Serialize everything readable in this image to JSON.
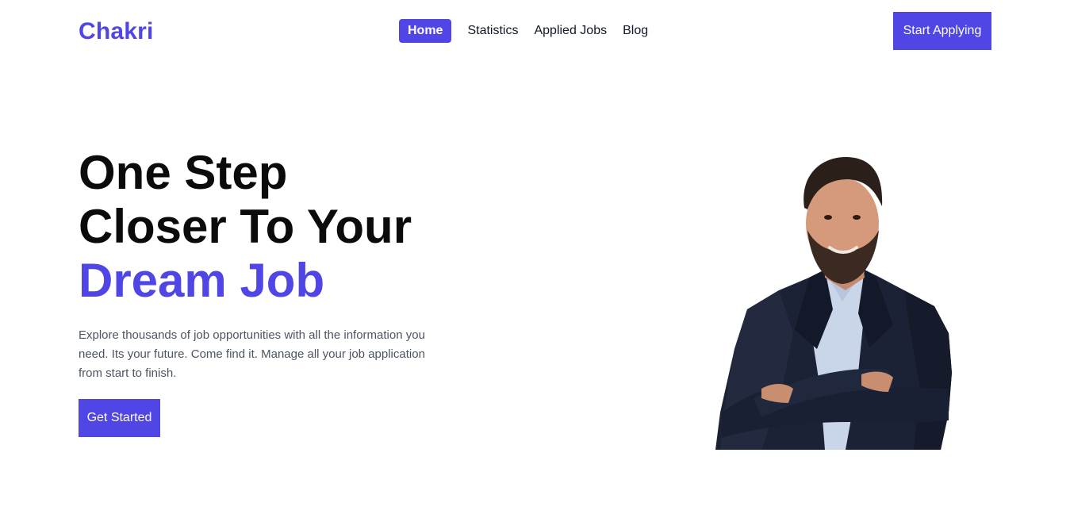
{
  "header": {
    "logo": "Chakri",
    "nav": [
      {
        "label": "Home",
        "active": true
      },
      {
        "label": "Statistics",
        "active": false
      },
      {
        "label": "Applied Jobs",
        "active": false
      },
      {
        "label": "Blog",
        "active": false
      }
    ],
    "cta_label": "Start Applying"
  },
  "hero": {
    "title_line1": "One Step",
    "title_line2": "Closer To Your",
    "title_accent": "Dream Job",
    "description": "Explore thousands of job opportunities with all the information you need. Its your future. Come find it. Manage all your job application from start to finish.",
    "button_label": "Get Started"
  },
  "colors": {
    "accent": "#4f46e5",
    "text": "#0b0b0b",
    "muted": "#4b5563"
  }
}
